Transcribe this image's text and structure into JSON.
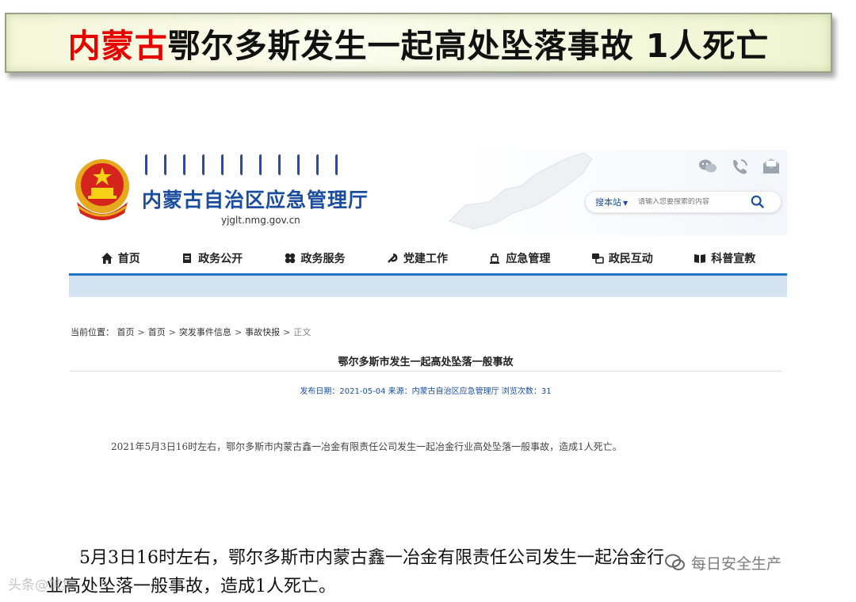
{
  "slide": {
    "title_red": "内蒙古",
    "title_rest": "鄂尔多斯发生一起高处坠落事故 1人死亡",
    "accent_red": "#e60000"
  },
  "site": {
    "org_name": "内蒙古自治区应急管理厅",
    "url": "yjglt.nmg.gov.cn",
    "brand_blue": "#1b4d9e",
    "top_icons": [
      "wechat-icon",
      "phone-icon",
      "mail-icon"
    ],
    "search": {
      "scope": "搜本站",
      "placeholder": "请输入您要搜索的内容",
      "icon": "search-icon"
    },
    "nav": [
      {
        "label": "首页",
        "icon": "home-icon"
      },
      {
        "label": "政务公开",
        "icon": "document-icon"
      },
      {
        "label": "政务服务",
        "icon": "service-icon"
      },
      {
        "label": "党建工作",
        "icon": "party-icon"
      },
      {
        "label": "应急管理",
        "icon": "emergency-icon"
      },
      {
        "label": "政民互动",
        "icon": "interaction-icon"
      },
      {
        "label": "科普宣教",
        "icon": "book-icon"
      }
    ]
  },
  "breadcrumb": {
    "prefix": "当前位置：",
    "items": [
      "首页",
      "首页",
      "突发事件信息",
      "事故快报"
    ],
    "current": "正文"
  },
  "article": {
    "title": "鄂尔多斯市发生一起高处坠落一般事故",
    "meta": "发布日期：2021-05-04 来源：内蒙古自治区应急管理厅 浏览次数：31",
    "body": "2021年5月3日16时左右，鄂尔多斯市内蒙古鑫一冶金有限责任公司发生一起冶金行业高处坠落一般事故，造成1人死亡。"
  },
  "caption": {
    "line1": "5月3日16时左右，鄂尔多斯市内蒙古鑫一冶金有限责任公司发生一起冶金行",
    "line2": "业高处坠落一般事故，造成1人死亡。"
  },
  "watermarks": {
    "left": "头条@筑集",
    "right": "每日安全生产"
  }
}
